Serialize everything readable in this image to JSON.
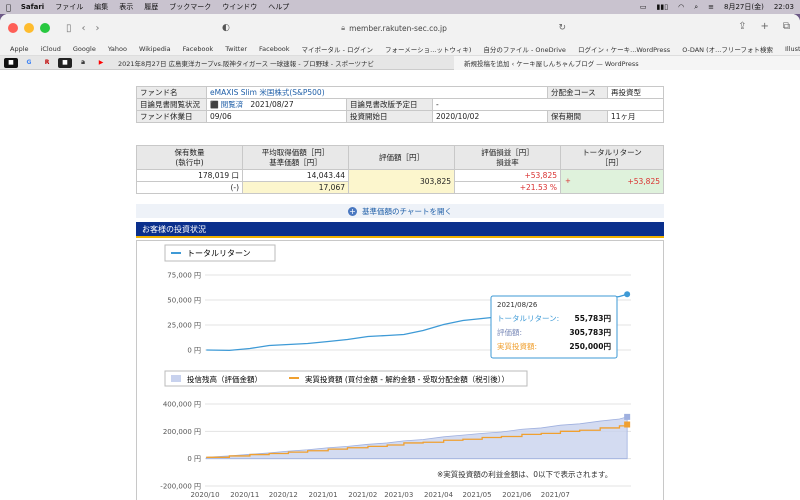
{
  "menubar": {
    "app": "Safari",
    "items": [
      "ファイル",
      "編集",
      "表示",
      "履歴",
      "ブックマーク",
      "ウインドウ",
      "ヘルプ"
    ],
    "date": "8月27日(金)",
    "time": "22:03"
  },
  "browser": {
    "url": "member.rakuten-sec.co.jp"
  },
  "favorites": [
    "Apple",
    "iCloud",
    "Google",
    "Yahoo",
    "Wikipedia",
    "Facebook",
    "Twitter",
    "Facebook",
    "マイポータル - ログイン",
    "フォーメーショ...ットウィキ)",
    "自分のファイル - OneDrive",
    "ログイン ‹ ケーキ...WordPress",
    "O-DAN (オ...フリーフォト検索",
    "Illustrations | unDraw"
  ],
  "tabs": {
    "tab1": "2021年8月27日 広島東洋カープvs.阪神タイガース 一球速報 - プロ野球 - スポーツナビ",
    "tab2": "新規投稿を追加 ‹ ケーキ屋しんちゃんブログ — WordPress"
  },
  "fund": {
    "name_label": "ファンド名",
    "name": "eMAXIS Slim 米国株式(S&P500)",
    "dist_label": "分配金コース",
    "dist": "再投資型",
    "prospectus_label": "目論見書閲覧状況",
    "prospectus_status": "閲覧済",
    "prospectus_date": "2021/08/27",
    "revision_label": "目論見書改版予定日",
    "revision": "-",
    "holiday_label": "ファンド休業日",
    "holiday": "09/06",
    "start_label": "投資開始日",
    "start": "2020/10/02",
    "period_label": "保有期間",
    "period": "11ヶ月"
  },
  "holdings": {
    "h_qty": "保有数量",
    "h_qty2": "(執行中)",
    "h_cost": "平均取得価額［円］",
    "h_cost2": "基準価額［円］",
    "h_value": "評価額［円］",
    "h_pl": "評価損益［円］",
    "h_pl2": "損益率",
    "h_total": "トータルリターン",
    "h_total2": "［円］",
    "qty": "178,019 口",
    "pending": "(-)",
    "avg_cost": "14,043.44",
    "base_price": "17,067",
    "value": "303,825",
    "pl": "+53,825",
    "pl_rate": "+21.53 %",
    "total_return": "+53,825"
  },
  "open_chart": "基準価額のチャートを開く",
  "section_title": "お客様の投資状況",
  "colors": {
    "total_return": "#3e9ad6",
    "balance": "#c8d2ee",
    "invested": "#f0a030",
    "header": "#0a2f8c"
  },
  "chart_data": [
    {
      "type": "line",
      "legend": [
        "トータルリターン"
      ],
      "y_ticks": [
        "75,000 円",
        "50,000 円",
        "25,000 円",
        "0 円",
        "-25,000 円"
      ],
      "ylim": [
        -25000,
        75000
      ],
      "x": [
        "2020/10/02",
        "2020/10/20",
        "2020/11/05",
        "2020/11/20",
        "2020/12/05",
        "2020/12/20",
        "2021/01/05",
        "2021/01/20",
        "2021/02/05",
        "2021/02/20",
        "2021/03/05",
        "2021/03/20",
        "2021/04/05",
        "2021/04/20",
        "2021/05/05",
        "2021/05/20",
        "2021/06/05",
        "2021/06/20",
        "2021/07/05",
        "2021/07/20",
        "2021/08/05",
        "2021/08/20",
        "2021/08/26"
      ],
      "series": [
        {
          "name": "トータルリターン",
          "values": [
            0,
            -400,
            1500,
            4500,
            5500,
            6500,
            8500,
            10500,
            13500,
            14500,
            15500,
            19500,
            25500,
            29500,
            31500,
            33500,
            36500,
            39500,
            44500,
            47500,
            50500,
            53500,
            55783
          ]
        }
      ],
      "tooltip": {
        "date": "2021/08/26",
        "total_label": "トータルリターン:",
        "total": "55,783円",
        "value_label": "評価額:",
        "value": "305,783円",
        "invested_label": "実質投資額:",
        "invested": "250,000円"
      }
    },
    {
      "type": "area",
      "legend": [
        "投信残高（評価金額）",
        "実質投資額 (買付金額 - 解約金額 - 受取分配金額（税引後））"
      ],
      "y_ticks": [
        "400,000 円",
        "200,000 円",
        "0 円",
        "-200,000 円"
      ],
      "ylim": [
        -200000,
        400000
      ],
      "x_ticks": [
        "2020/10",
        "2020/11",
        "2020/12",
        "2021/01",
        "2021/02",
        "2021/03",
        "2021/04",
        "2021/05",
        "2021/06",
        "2021/07"
      ],
      "x": [
        "2020/10/02",
        "2020/10/20",
        "2020/11/05",
        "2020/11/20",
        "2020/12/05",
        "2020/12/20",
        "2021/01/05",
        "2021/01/20",
        "2021/02/05",
        "2021/02/20",
        "2021/03/05",
        "2021/03/20",
        "2021/04/05",
        "2021/04/20",
        "2021/05/05",
        "2021/05/20",
        "2021/06/05",
        "2021/06/20",
        "2021/07/05",
        "2021/07/20",
        "2021/08/05",
        "2021/08/20",
        "2021/08/26"
      ],
      "series": [
        {
          "name": "投信残高（評価金額）",
          "values": [
            10000,
            20000,
            32000,
            42000,
            55000,
            65000,
            80000,
            90000,
            105000,
            115000,
            130000,
            140000,
            160000,
            172000,
            185000,
            195000,
            215000,
            225000,
            245000,
            255000,
            275000,
            290000,
            305783
          ]
        },
        {
          "name": "実質投資額 (買付金額 - 解約金額 - 受取分配金額（税引後））",
          "values": [
            10000,
            20000,
            30000,
            38000,
            48000,
            58000,
            70000,
            80000,
            90000,
            100000,
            115000,
            120000,
            135000,
            142000,
            155000,
            162000,
            178000,
            185000,
            200000,
            208000,
            225000,
            240000,
            250000
          ]
        }
      ],
      "note": "※実質投資額の利益金額は、0以下で表示されます。"
    }
  ]
}
